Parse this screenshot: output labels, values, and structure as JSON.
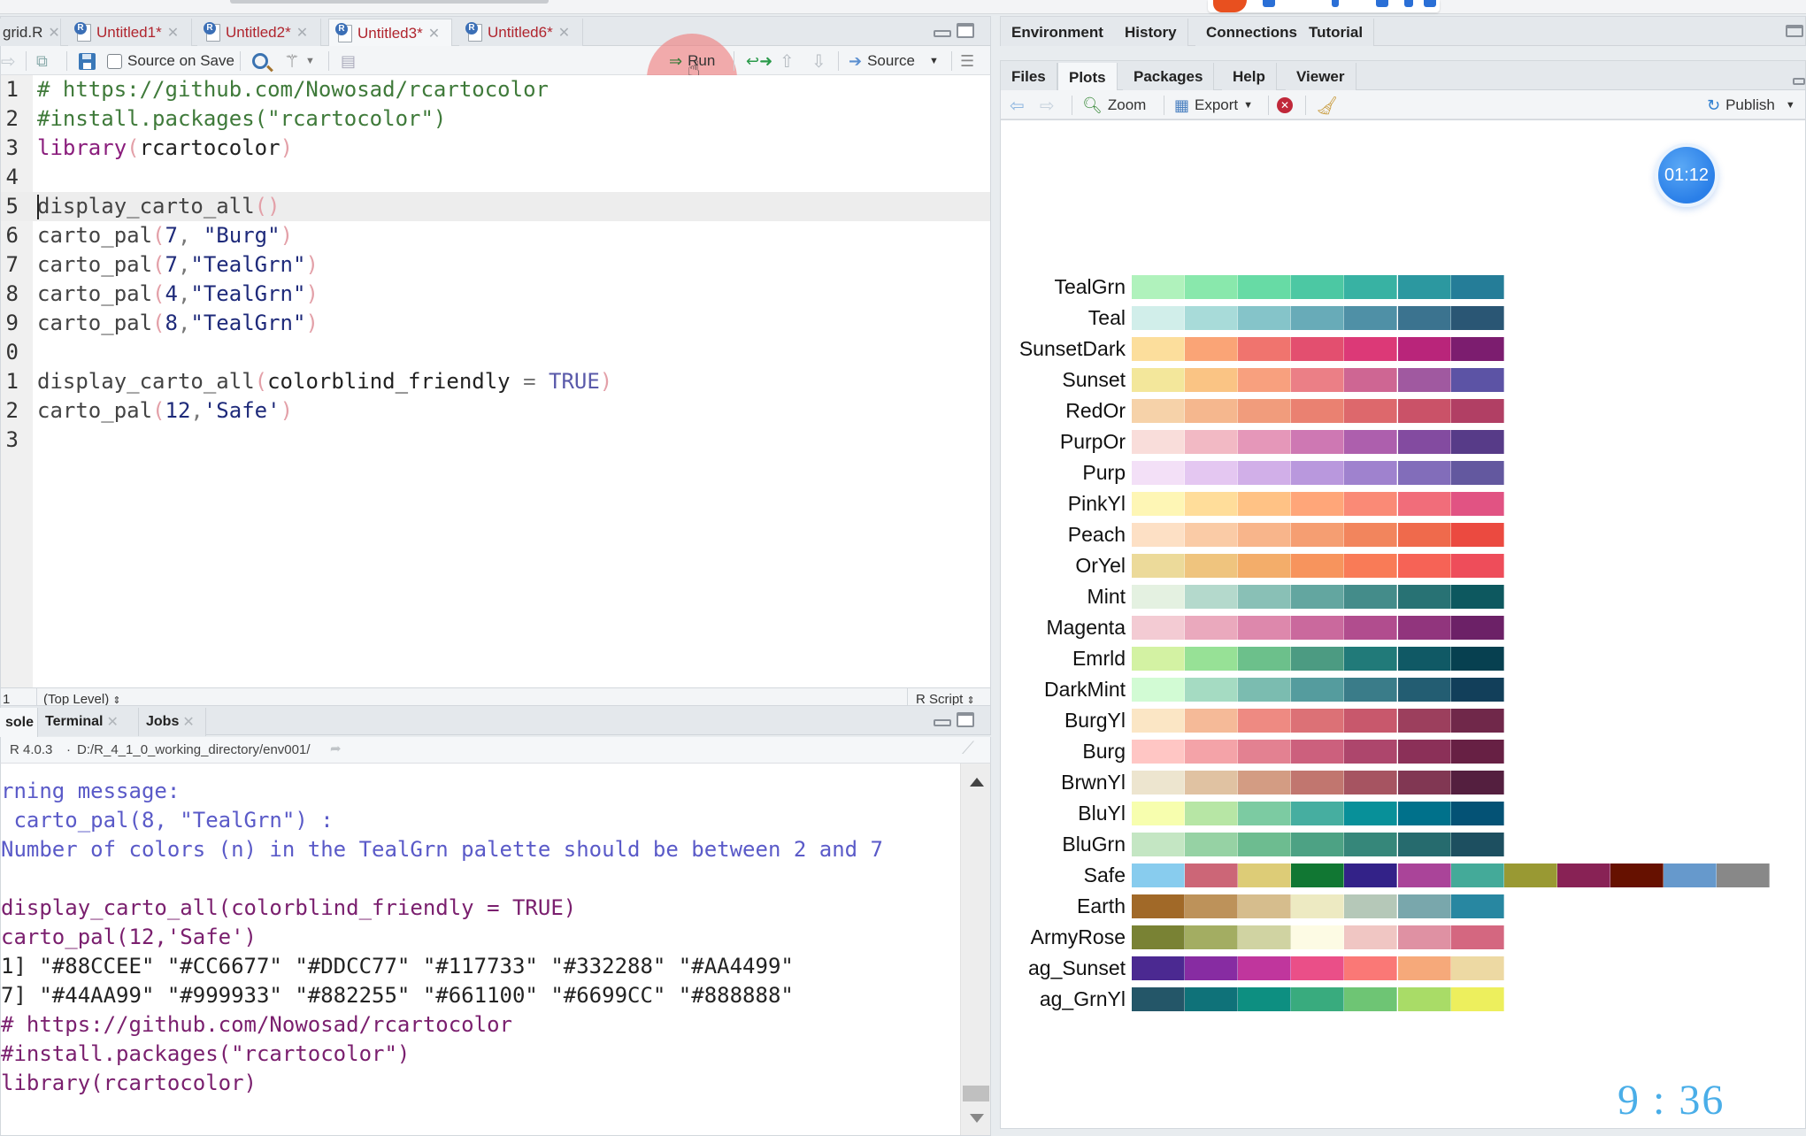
{
  "source_tabs": [
    {
      "label": "grid.R",
      "modified": false,
      "active": false
    },
    {
      "label": "Untitled1*",
      "modified": true,
      "active": false
    },
    {
      "label": "Untitled2*",
      "modified": true,
      "active": false
    },
    {
      "label": "Untitled3*",
      "modified": true,
      "active": true
    },
    {
      "label": "Untitled6*",
      "modified": true,
      "active": false
    }
  ],
  "editor_toolbar": {
    "source_on_save_label": "Source on Save",
    "source_on_save_checked": false,
    "run_label": "Run",
    "source_label": "Source"
  },
  "editor": {
    "current_line": 5,
    "lines": [
      {
        "num": "1",
        "tokens": [
          {
            "t": "# https://github.com/Nowosad/rcartocolor",
            "c": "com"
          }
        ]
      },
      {
        "num": "2",
        "tokens": [
          {
            "t": "#install.packages(\"rcartocolor\")",
            "c": "com"
          }
        ]
      },
      {
        "num": "3",
        "tokens": [
          {
            "t": "library",
            "c": "kw"
          },
          {
            "t": "(",
            "c": "par"
          },
          {
            "t": "rcartocolor",
            "c": "id"
          },
          {
            "t": ")",
            "c": "par"
          }
        ]
      },
      {
        "num": "4",
        "tokens": []
      },
      {
        "num": "5",
        "tokens": [
          {
            "t": "display_carto_all",
            "c": "fn"
          },
          {
            "t": "()",
            "c": "par"
          }
        ]
      },
      {
        "num": "6",
        "tokens": [
          {
            "t": "carto_pal",
            "c": "fn"
          },
          {
            "t": "(",
            "c": "par"
          },
          {
            "t": "7",
            "c": "num"
          },
          {
            "t": ", ",
            "c": "op"
          },
          {
            "t": "\"Burg\"",
            "c": "str"
          },
          {
            "t": ")",
            "c": "par"
          }
        ]
      },
      {
        "num": "7",
        "tokens": [
          {
            "t": "carto_pal",
            "c": "fn"
          },
          {
            "t": "(",
            "c": "par"
          },
          {
            "t": "7",
            "c": "num"
          },
          {
            "t": ",",
            "c": "op"
          },
          {
            "t": "\"TealGrn\"",
            "c": "str"
          },
          {
            "t": ")",
            "c": "par"
          }
        ]
      },
      {
        "num": "8",
        "tokens": [
          {
            "t": "carto_pal",
            "c": "fn"
          },
          {
            "t": "(",
            "c": "par"
          },
          {
            "t": "4",
            "c": "num"
          },
          {
            "t": ",",
            "c": "op"
          },
          {
            "t": "\"TealGrn\"",
            "c": "str"
          },
          {
            "t": ")",
            "c": "par"
          }
        ]
      },
      {
        "num": "9",
        "tokens": [
          {
            "t": "carto_pal",
            "c": "fn"
          },
          {
            "t": "(",
            "c": "par"
          },
          {
            "t": "8",
            "c": "num"
          },
          {
            "t": ",",
            "c": "op"
          },
          {
            "t": "\"TealGrn\"",
            "c": "str"
          },
          {
            "t": ")",
            "c": "par"
          }
        ]
      },
      {
        "num": "0",
        "tokens": []
      },
      {
        "num": "1",
        "tokens": [
          {
            "t": "display_carto_all",
            "c": "fn"
          },
          {
            "t": "(",
            "c": "par"
          },
          {
            "t": "colorblind_friendly",
            "c": "id"
          },
          {
            "t": " = ",
            "c": "op"
          },
          {
            "t": "TRUE",
            "c": "bool"
          },
          {
            "t": ")",
            "c": "par"
          }
        ]
      },
      {
        "num": "2",
        "tokens": [
          {
            "t": "carto_pal",
            "c": "fn"
          },
          {
            "t": "(",
            "c": "par"
          },
          {
            "t": "12",
            "c": "num"
          },
          {
            "t": ",",
            "c": "op"
          },
          {
            "t": "'Safe'",
            "c": "str"
          },
          {
            "t": ")",
            "c": "par"
          }
        ]
      },
      {
        "num": "3",
        "tokens": []
      }
    ]
  },
  "statusbar": {
    "position": "1",
    "scope": "(Top Level)",
    "file_type": "R Script"
  },
  "console_tabs": [
    {
      "label": "sole",
      "active": true,
      "closable": false
    },
    {
      "label": "Terminal",
      "active": false,
      "closable": true
    },
    {
      "label": "Jobs",
      "active": false,
      "closable": true
    }
  ],
  "console_path": {
    "r_version": "R 4.0.3",
    "directory": "D:/R_4_1_0_working_directory/env001/"
  },
  "console_lines": [
    {
      "text": "rning message:",
      "kind": "warn"
    },
    {
      "text": " carto_pal(8, \"TealGrn\") :",
      "kind": "warn"
    },
    {
      "text": "Number of colors (n) in the TealGrn palette should be between 2 and 7",
      "kind": "warn"
    },
    {
      "text": "",
      "kind": "out"
    },
    {
      "text": "display_carto_all(colorblind_friendly = TRUE)",
      "kind": "cmd"
    },
    {
      "text": "carto_pal(12,'Safe')",
      "kind": "cmd"
    },
    {
      "text": "1] \"#88CCEE\" \"#CC6677\" \"#DDCC77\" \"#117733\" \"#332288\" \"#AA4499\"",
      "kind": "out"
    },
    {
      "text": "7] \"#44AA99\" \"#999933\" \"#882255\" \"#661100\" \"#6699CC\" \"#888888\"",
      "kind": "out"
    },
    {
      "text": "# https://github.com/Nowosad/rcartocolor",
      "kind": "cmd"
    },
    {
      "text": "#install.packages(\"rcartocolor\")",
      "kind": "cmd"
    },
    {
      "text": "library(rcartocolor)",
      "kind": "cmd"
    }
  ],
  "right_top_tabs": [
    {
      "label": "Environment"
    },
    {
      "label": "History"
    },
    {
      "label": "Connections"
    },
    {
      "label": "Tutorial"
    }
  ],
  "right_bottom_tabs": [
    {
      "label": "Files",
      "active": false
    },
    {
      "label": "Plots",
      "active": true
    },
    {
      "label": "Packages",
      "active": false
    },
    {
      "label": "Help",
      "active": false
    },
    {
      "label": "Viewer",
      "active": false
    }
  ],
  "plot_toolbar": {
    "zoom_label": "Zoom",
    "export_label": "Export",
    "publish_label": "Publish"
  },
  "timer": "01:12",
  "clock": "9 : 36",
  "chart_data": {
    "type": "heatmap",
    "title": "",
    "description": "rcartocolor display_carto_all() palette swatches",
    "palettes": [
      {
        "name": "TealGrn",
        "colors": [
          "#b0f2bc",
          "#89e8ac",
          "#67dba5",
          "#4cc8a3",
          "#38b2a3",
          "#2c98a0",
          "#257d98"
        ]
      },
      {
        "name": "Teal",
        "colors": [
          "#d1eeea",
          "#a8dbd9",
          "#85c4c9",
          "#68abb8",
          "#4f90a6",
          "#3b738f",
          "#2a5674"
        ]
      },
      {
        "name": "SunsetDark",
        "colors": [
          "#fcde9c",
          "#faa476",
          "#f0746e",
          "#e34f6f",
          "#dc3977",
          "#b9257a",
          "#7c1d6f"
        ]
      },
      {
        "name": "Sunset",
        "colors": [
          "#f3e79b",
          "#fac484",
          "#f8a07e",
          "#eb7f86",
          "#ce6693",
          "#a059a0",
          "#5c53a5"
        ]
      },
      {
        "name": "RedOr",
        "colors": [
          "#f6d2a9",
          "#f5b78e",
          "#f19c7c",
          "#ea8171",
          "#dd686c",
          "#ca5268",
          "#b13f64"
        ]
      },
      {
        "name": "PurpOr",
        "colors": [
          "#f9ddda",
          "#f2b9c4",
          "#e597b9",
          "#ce78b3",
          "#ad5fad",
          "#834ba0",
          "#573b88"
        ]
      },
      {
        "name": "Purp",
        "colors": [
          "#f3e0f7",
          "#e4c7f1",
          "#d1afe8",
          "#b998dd",
          "#9f82ce",
          "#826dba",
          "#63589f"
        ]
      },
      {
        "name": "PinkYl",
        "colors": [
          "#fef6b5",
          "#ffdd9a",
          "#ffc285",
          "#ffa679",
          "#fa8a76",
          "#f16d7a",
          "#e15383"
        ]
      },
      {
        "name": "Peach",
        "colors": [
          "#fde0c5",
          "#facba6",
          "#f8b58b",
          "#f59e72",
          "#f2855d",
          "#ef6a4c",
          "#eb4a40"
        ]
      },
      {
        "name": "OrYel",
        "colors": [
          "#ecda9a",
          "#efc47e",
          "#f3ad6a",
          "#f7945d",
          "#f97b57",
          "#f66356",
          "#ee4d5a"
        ]
      },
      {
        "name": "Mint",
        "colors": [
          "#e4f1e1",
          "#b4d9cc",
          "#89c0b6",
          "#63a6a0",
          "#448c8a",
          "#287274",
          "#0d585f"
        ]
      },
      {
        "name": "Magenta",
        "colors": [
          "#f3cbd3",
          "#eaa9bd",
          "#dd88ac",
          "#ca699d",
          "#b14d8e",
          "#91357d",
          "#6c2167"
        ]
      },
      {
        "name": "Emrld",
        "colors": [
          "#d3f2a3",
          "#97e196",
          "#6cc08b",
          "#4c9b82",
          "#217a79",
          "#105965",
          "#074050"
        ]
      },
      {
        "name": "DarkMint",
        "colors": [
          "#d2fbd4",
          "#a5dbc2",
          "#7bbcb0",
          "#559c9e",
          "#3a7c89",
          "#235d72",
          "#123f5a"
        ]
      },
      {
        "name": "BurgYl",
        "colors": [
          "#fbe6c5",
          "#f5ba98",
          "#ee8a82",
          "#dc7176",
          "#c8586c",
          "#9c3f5d",
          "#70284a"
        ]
      },
      {
        "name": "Burg",
        "colors": [
          "#ffc6c4",
          "#f4a3a8",
          "#e38191",
          "#cc607d",
          "#ad466c",
          "#8b3058",
          "#672044"
        ]
      },
      {
        "name": "BrwnYl",
        "colors": [
          "#ede5cf",
          "#e0c2a2",
          "#d39c83",
          "#c1766f",
          "#a65461",
          "#813753",
          "#541f3f"
        ]
      },
      {
        "name": "BluYl",
        "colors": [
          "#f7feae",
          "#b7e6a5",
          "#7ccba2",
          "#46aea0",
          "#089099",
          "#00718b",
          "#045275"
        ]
      },
      {
        "name": "BluGrn",
        "colors": [
          "#c4e6c3",
          "#96d2a4",
          "#6dbc90",
          "#4da284",
          "#36877a",
          "#266b6e",
          "#1d4f60"
        ]
      },
      {
        "name": "Safe",
        "colors": [
          "#88CCEE",
          "#CC6677",
          "#DDCC77",
          "#117733",
          "#332288",
          "#AA4499",
          "#44AA99",
          "#999933",
          "#882255",
          "#661100",
          "#6699CC",
          "#888888"
        ]
      },
      {
        "name": "Earth",
        "colors": [
          "#A16928",
          "#bd925a",
          "#d6bd8d",
          "#edeac2",
          "#b5c8b8",
          "#79a7ac",
          "#2887a1"
        ]
      },
      {
        "name": "ArmyRose",
        "colors": [
          "#798234",
          "#a3ad62",
          "#d0d3a2",
          "#fdfbe4",
          "#f0c6c3",
          "#df91a3",
          "#d46780"
        ]
      },
      {
        "name": "ag_Sunset",
        "colors": [
          "#4b2991",
          "#872ca2",
          "#c0369d",
          "#ea4f88",
          "#fa7876",
          "#f6a97a",
          "#edd9a3"
        ]
      },
      {
        "name": "ag_GrnYl",
        "colors": [
          "#245668",
          "#0f7279",
          "#0d8f81",
          "#39ab7e",
          "#6ec574",
          "#a9dc67",
          "#edef5d"
        ]
      }
    ]
  }
}
